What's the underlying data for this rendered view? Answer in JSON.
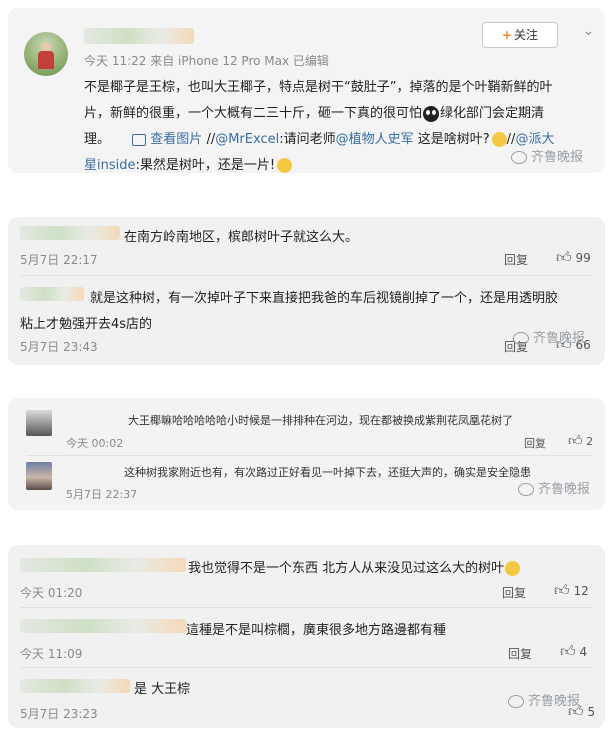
{
  "post": {
    "meta": "今天 11:22 来自 iPhone 12 Pro Max  已编辑",
    "follow_label": "关注",
    "body_line1": "不是椰子是王棕，也叫大王椰子，特点是树干“鼓肚子”，掉落的是个叶鞘新鲜的叶",
    "body_line2": "片，新鲜的很重，一个大概有二三十斤，砸一下真的很可怕",
    "body_line2b": "绿化部门会定期清",
    "body_line3a": "理。",
    "view_image": "查看图片",
    "line3_b": "//",
    "mention1": "@MrExcel",
    "line3_c": ":请问老师",
    "mention2": "@植物人史军",
    "line3_d": " 这是啥树叶?",
    "line3_e": "//",
    "mention3": "@派大",
    "mention3b": "星inside",
    "line4_b": ":果然是树叶，还是一片!",
    "watermark": "齐鲁晚报"
  },
  "group1": {
    "c1_text": "在南方岭南地区，槟郎树叶子就这么大。",
    "c1_time": "5月7日 22:17",
    "c1_reply": "回复",
    "c1_likes": "99",
    "c2_line1": "就是这种树，有一次掉叶子下来直接把我爸的车后视镜削掉了一个，还是用透明胶",
    "c2_line2": "粘上才勉强开去4s店的",
    "c2_time": "5月7日 23:43",
    "c2_reply": "回复",
    "c2_likes": "66",
    "watermark": "齐鲁晚报"
  },
  "group2": {
    "c1_text": "大王椰嘛哈哈哈哈哈小时候是一排排种在河边，现在都被换成紫荆花凤凰花树了",
    "c1_time": "今天 00:02",
    "c1_reply": "回复",
    "c1_likes": "2",
    "c2_text": "这种树我家附近也有，有次路过正好看见一叶掉下去，还挺大声的，确实是安全隐患",
    "c2_time": "5月7日 22:37",
    "watermark": "齐鲁晚报"
  },
  "group3": {
    "c1_text": "我也觉得不是一个东西 北方人从来没见过这么大的树叶",
    "c1_time": "今天 01:20",
    "c1_reply": "回复",
    "c1_likes": "12",
    "c2_text": "這種是不是叫棕櫚，廣東很多地方路邊都有種",
    "c2_time": "今天 11:09",
    "c2_reply": "回复",
    "c2_likes": "4",
    "c3_text": "是 大王棕",
    "c3_time": "5月7日 23:23",
    "c3_likes": "5",
    "watermark": "齐鲁晚报"
  },
  "colors": {
    "link": "#3a6ea5",
    "card_bg": "#f1f1f1",
    "meta": "#8a8a8a"
  }
}
